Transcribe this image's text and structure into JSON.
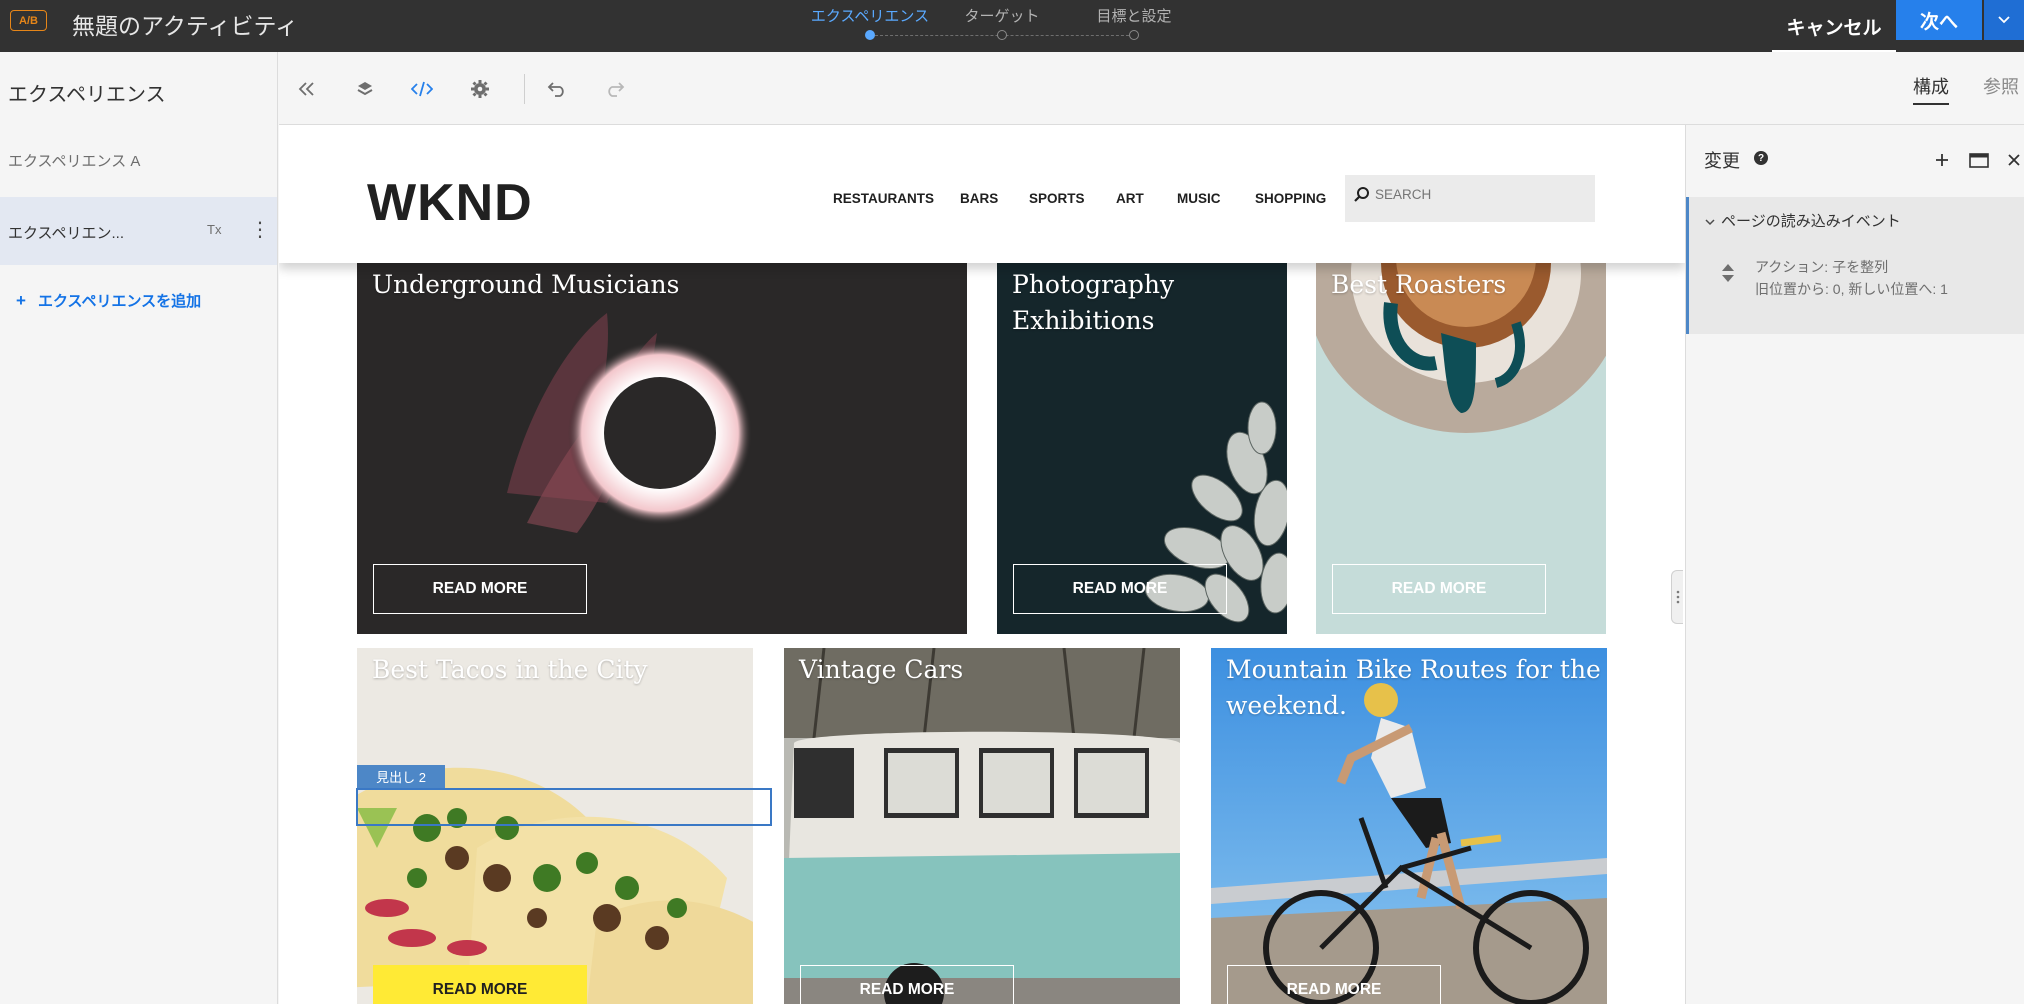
{
  "topbar": {
    "badge": "A/B",
    "activity_title": "無題のアクティビティ",
    "steps": [
      {
        "label": "エクスペリエンス",
        "active": true
      },
      {
        "label": "ターゲット",
        "active": false
      },
      {
        "label": "目標と設定",
        "active": false
      }
    ],
    "cancel_label": "キャンセル",
    "next_label": "次へ",
    "next_caret": "⌄"
  },
  "left_panel": {
    "title": "エクスペリエンス",
    "experiences": [
      {
        "label": "エクスペリエンス A",
        "selected": false
      },
      {
        "label": "エクスペリエン...",
        "selected": true,
        "rename_icon": "Tx",
        "more_icon": "⋮"
      }
    ],
    "add_label": "エクスペリエンスを追加",
    "add_icon": "+"
  },
  "toolbar": {
    "icons": [
      "collapse-icon",
      "layers-icon",
      "code-icon",
      "settings-icon",
      "undo-icon",
      "redo-icon"
    ],
    "tabs": [
      {
        "label": "構成",
        "active": true
      },
      {
        "label": "参照",
        "active": false
      }
    ]
  },
  "site": {
    "logo": "WKND",
    "nav": [
      "RESTAURANTS",
      "BARS",
      "SPORTS",
      "ART",
      "MUSIC",
      "SHOPPING"
    ],
    "search_placeholder": "SEARCH",
    "cards": [
      {
        "title": "Underground Musicians",
        "button": "READ MORE"
      },
      {
        "title": "Photography Exhibitions",
        "button": "READ MORE"
      },
      {
        "title": "Best Roasters",
        "button": "READ MORE"
      },
      {
        "title": "Best Tacos in the City",
        "button": "READ MORE"
      },
      {
        "title": "Vintage Cars",
        "button": "READ MORE"
      },
      {
        "title": "Mountain Bike Routes for the weekend.",
        "button": "READ MORE"
      }
    ],
    "selection_tag": "見出し 2"
  },
  "right_panel": {
    "title": "変更",
    "help_icon": "?",
    "section_title": "ページの読み込みイベント",
    "action_text": "アクション: 子を整列",
    "detail_text": "旧位置から: 0, 新しい位置へ: 1"
  },
  "colors": {
    "topbar_bg": "#323232",
    "accent_blue": "#2680eb",
    "active_step": "#5aa9ff",
    "selection_blue": "#4d87c7",
    "ab_badge_orange": "#e68619",
    "read_more_yellow": "#ffea35"
  }
}
